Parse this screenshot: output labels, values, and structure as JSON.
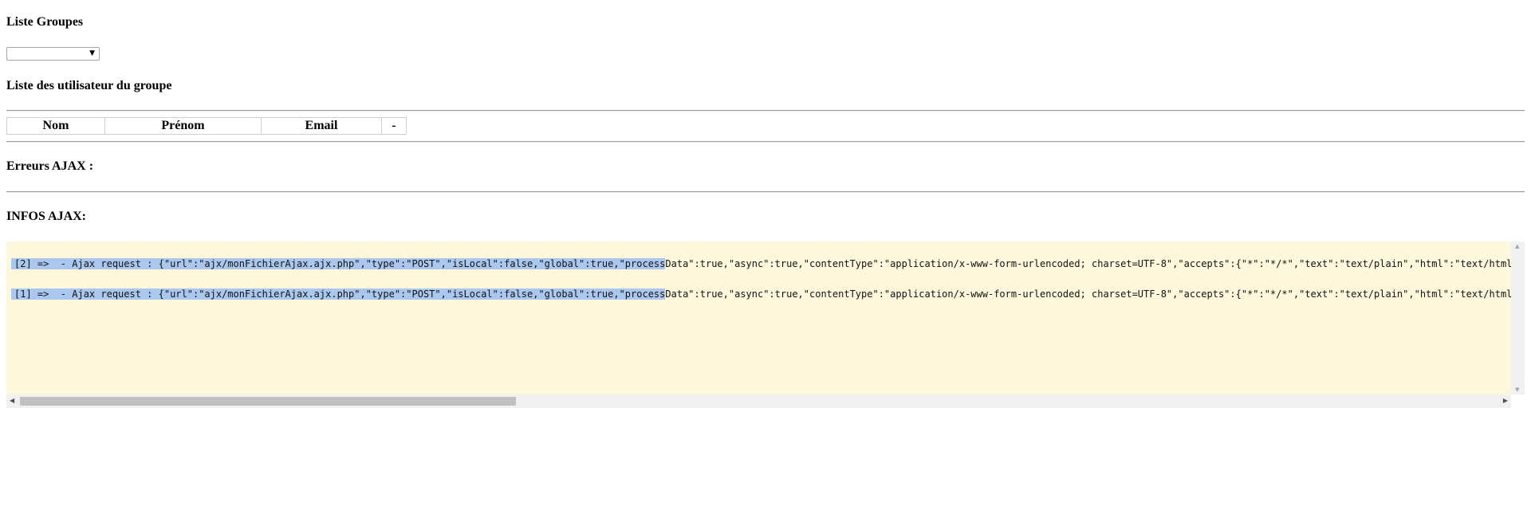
{
  "groups": {
    "title": "Liste Groupes",
    "select_value": "",
    "select_caret_icon": "dropdown-arrow"
  },
  "users": {
    "title": "Liste des utilisateur du groupe",
    "columns": [
      "Nom",
      "Prénom",
      "Email",
      "-"
    ]
  },
  "errors": {
    "title": "Erreurs AJAX :"
  },
  "infos": {
    "title": "INFOS AJAX:",
    "lines": [
      {
        "selected": "[2] =>  - Ajax request : {\"url\":\"ajx/monFichierAjax.ajx.php\",\"type\":\"POST\",\"isLocal\":false,\"global\":true,\"process",
        "rest": "Data\":true,\"async\":true,\"contentType\":\"application/x-www-form-urlencoded; charset=UTF-8\",\"accepts\":{\"*\":\"*/*\",\"text\":\"text/plain\",\"html\":\"text/html\",\""
      },
      {
        "selected": "[1] =>  - Ajax request : {\"url\":\"ajx/monFichierAjax.ajx.php\",\"type\":\"POST\",\"isLocal\":false,\"global\":true,\"process",
        "rest": "Data\":true,\"async\":true,\"contentType\":\"application/x-www-form-urlencoded; charset=UTF-8\",\"accepts\":{\"*\":\"*/*\",\"text\":\"text/plain\",\"html\":\"text/html\",\""
      }
    ],
    "horizontal_scroll_fraction": 0.33
  },
  "colors": {
    "log_background": "#fdf7dc",
    "selection": "#aac8ef",
    "scrollbar_track": "#f1f1f1",
    "scrollbar_thumb": "#c1c1c1"
  }
}
